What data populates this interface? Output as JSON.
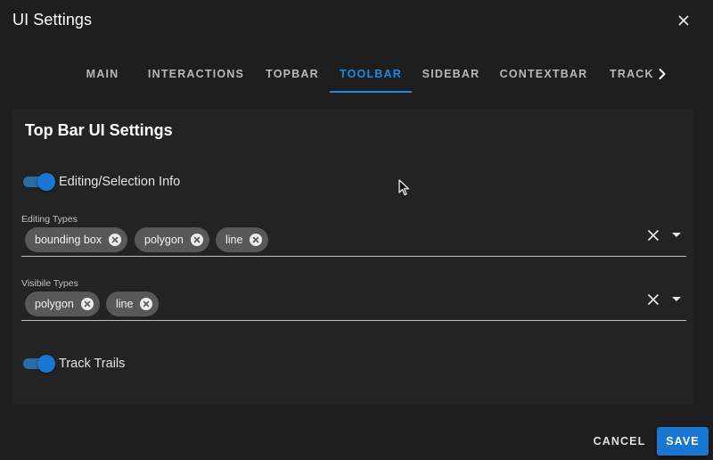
{
  "dialog": {
    "title": "UI Settings",
    "close_icon": "close-icon"
  },
  "tabs": {
    "items": [
      {
        "label": "MAIN"
      },
      {
        "label": "INTERACTIONS"
      },
      {
        "label": "TOPBAR"
      },
      {
        "label": "TOOLBAR",
        "active": true
      },
      {
        "label": "SIDEBAR"
      },
      {
        "label": "CONTEXTBAR"
      },
      {
        "label": "TRACK"
      }
    ],
    "next_icon": "chevron-right-icon"
  },
  "card": {
    "title": "Top Bar UI Settings",
    "editing_info_toggle": {
      "label": "Editing/Selection Info",
      "on": true
    },
    "editing_types": {
      "label": "Editing Types",
      "chips": [
        "bounding box",
        "polygon",
        "line"
      ]
    },
    "visible_types": {
      "label": "Visibile Types",
      "chips": [
        "polygon",
        "line"
      ]
    },
    "track_trails_toggle": {
      "label": "Track Trails",
      "on": true
    }
  },
  "footer": {
    "cancel_label": "CANCEL",
    "save_label": "SAVE"
  },
  "colors": {
    "background": "#1e1e1e",
    "accent": "#1976d2",
    "chip": "#585858"
  }
}
